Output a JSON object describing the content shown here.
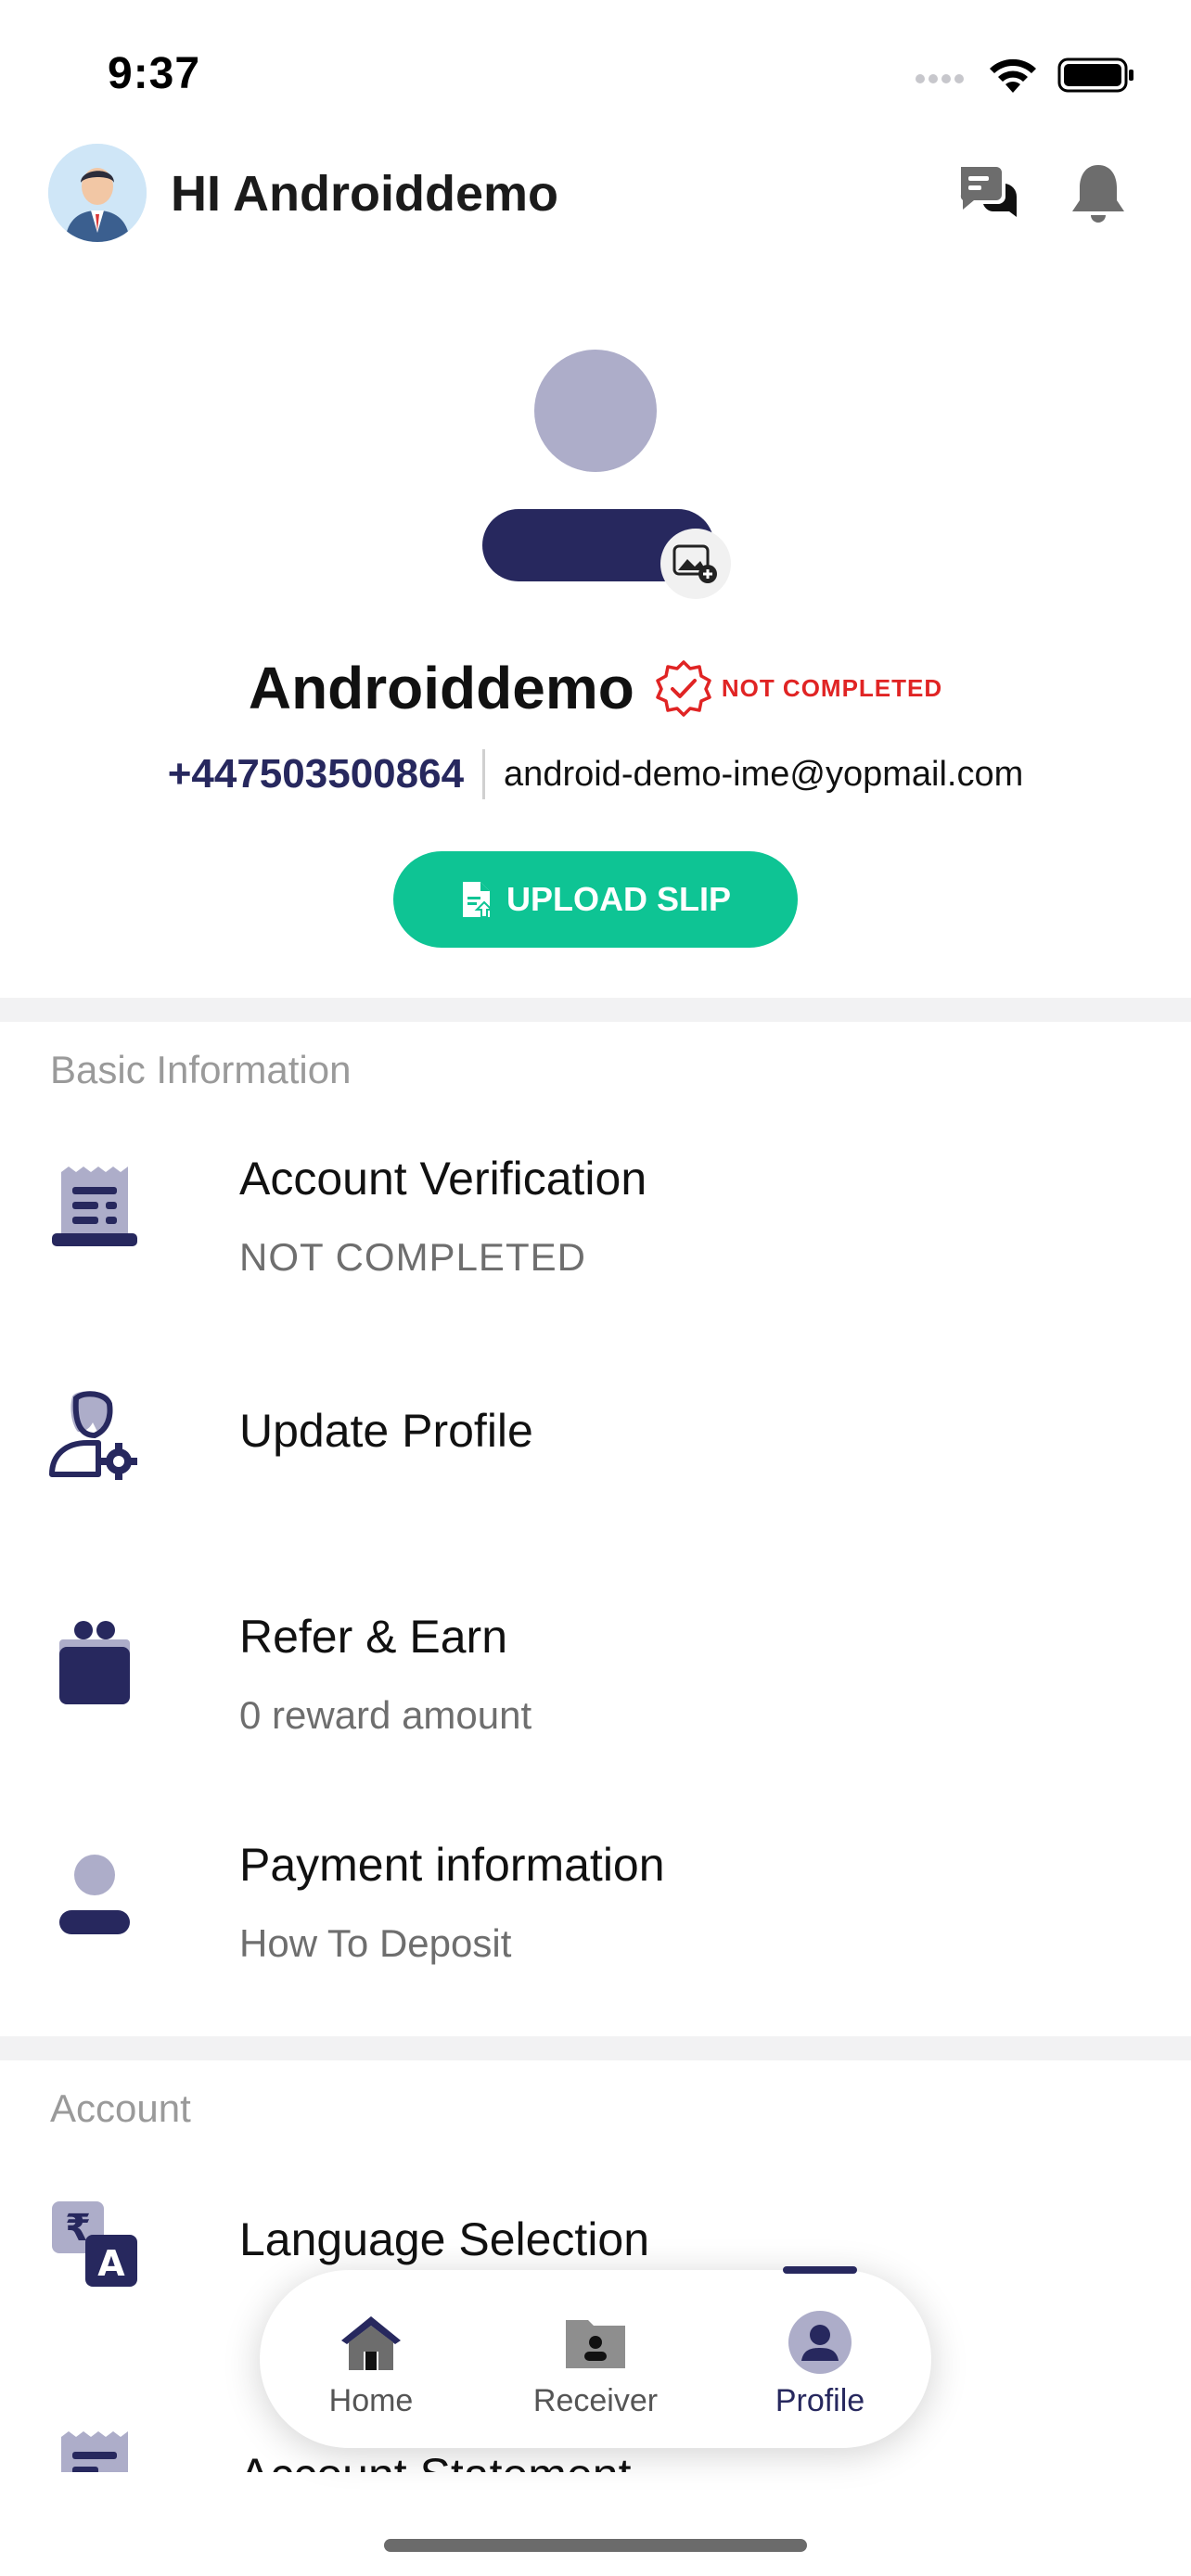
{
  "status_bar": {
    "time": "9:37"
  },
  "header": {
    "greeting": "HI Androiddemo"
  },
  "profile": {
    "name": "Androiddemo",
    "verification_status": "NOT COMPLETED",
    "phone": "+447503500864",
    "email": "android-demo-ime@yopmail.com",
    "upload_button_label": "UPLOAD SLIP"
  },
  "basic_information": {
    "title": "Basic Information",
    "items": [
      {
        "title": "Account Verification",
        "subtitle": "NOT COMPLETED",
        "icon": "receipt-icon"
      },
      {
        "title": "Update Profile",
        "subtitle": "",
        "icon": "user-settings-icon"
      },
      {
        "title": "Refer & Earn",
        "subtitle": "0 reward amount",
        "icon": "gift-icon"
      },
      {
        "title": "Payment information",
        "subtitle": "How To Deposit",
        "icon": "person-icon"
      }
    ]
  },
  "account": {
    "title": "Account",
    "items": [
      {
        "title": "Language Selection",
        "icon": "translate-icon"
      },
      {
        "title": "Account Statement",
        "icon": "statement-icon"
      }
    ]
  },
  "bottom_nav": {
    "tabs": [
      {
        "label": "Home",
        "icon": "home-icon"
      },
      {
        "label": "Receiver",
        "icon": "receiver-icon"
      },
      {
        "label": "Profile",
        "icon": "profile-icon",
        "active": true
      }
    ]
  },
  "colors": {
    "primary": "#27285e",
    "accent_green": "#0ec494",
    "error_red": "#e02424",
    "muted_text": "#9a9a9a"
  }
}
